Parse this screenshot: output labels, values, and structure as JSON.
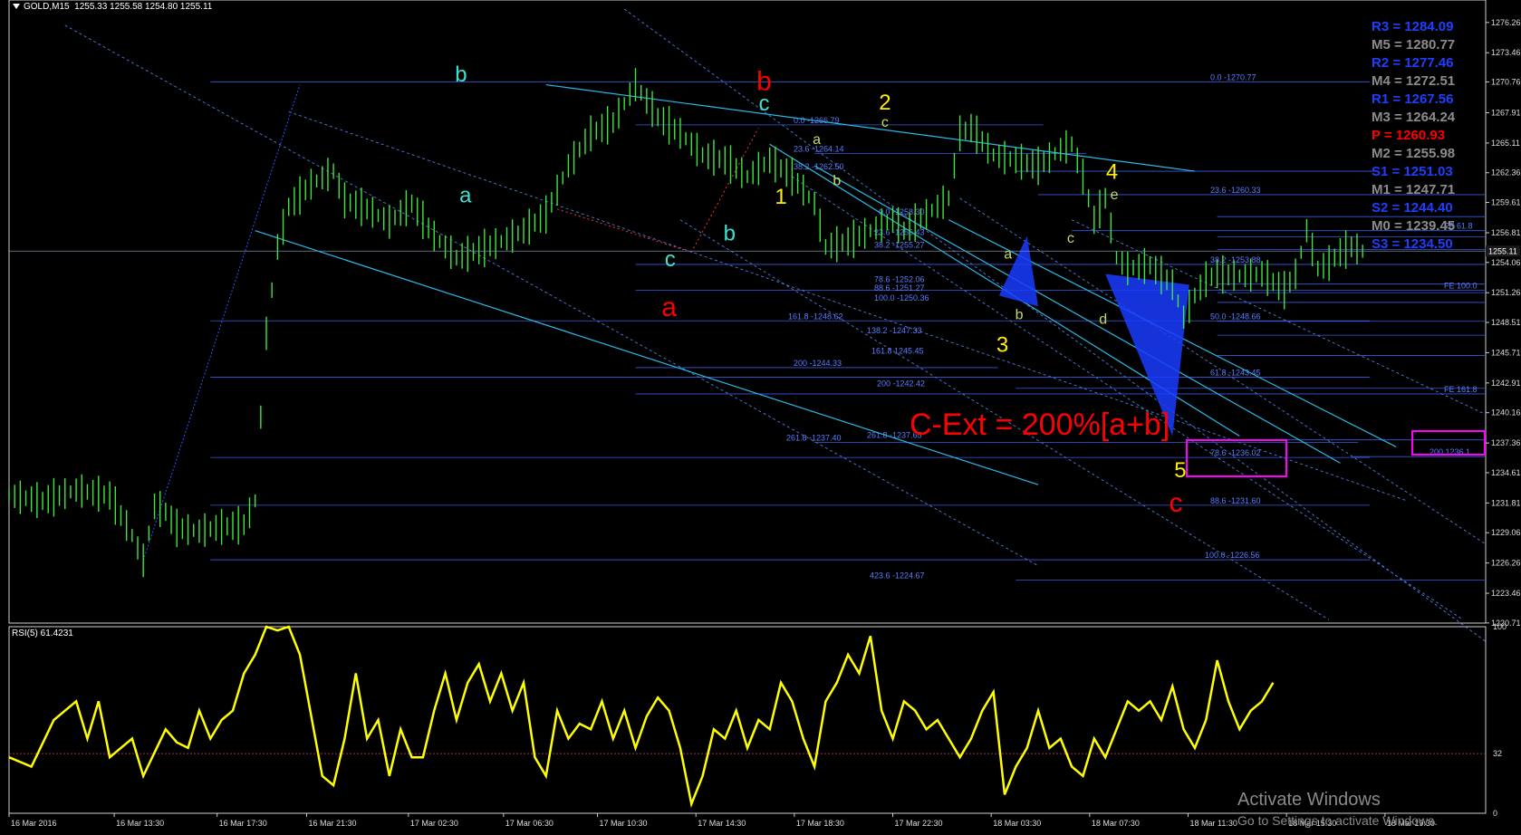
{
  "header": {
    "symbol": "GOLD,M15",
    "ohlc": "1255.33 1255.58 1254.80 1255.11"
  },
  "rsi_label": "RSI(5) 61.4231",
  "pivots": [
    {
      "label": "R3 = 1284.09",
      "color": "#1f3fff"
    },
    {
      "label": "M5 = 1280.77",
      "color": "#8c8c8c"
    },
    {
      "label": "R2 = 1277.46",
      "color": "#1f3fff"
    },
    {
      "label": "M4 = 1272.51",
      "color": "#8c8c8c"
    },
    {
      "label": "R1 = 1267.56",
      "color": "#1f3fff"
    },
    {
      "label": "M3 = 1264.24",
      "color": "#8c8c8c"
    },
    {
      "label": "P  = 1260.93",
      "color": "#ff0000"
    },
    {
      "label": "M2 = 1255.98",
      "color": "#8c8c8c"
    },
    {
      "label": "S1 = 1251.03",
      "color": "#1f3fff"
    },
    {
      "label": "M1 = 1247.71",
      "color": "#8c8c8c"
    },
    {
      "label": "S2 = 1244.40",
      "color": "#1f3fff"
    },
    {
      "label": "M0 = 1239.45",
      "color": "#8c8c8c"
    },
    {
      "label": "S3 = 1234.50",
      "color": "#1f3fff"
    }
  ],
  "annotation": "C-Ext = 200%[a+b]",
  "watermark": {
    "line1": "Activate Windows",
    "line2": "Go to Settings to activate Windows."
  },
  "wave_labels": [
    {
      "text": "b",
      "color": "#40e0d0",
      "time": 40.4,
      "price": 1270.8
    },
    {
      "text": "a",
      "color": "#40e0d0",
      "time": 40.8,
      "price": 1259.6
    },
    {
      "text": "c",
      "color": "#40e0d0",
      "time": 59.1,
      "price": 1253.7
    },
    {
      "text": "b",
      "color": "#40e0d0",
      "time": 64.4,
      "price": 1256.1
    },
    {
      "text": "c",
      "color": "#40e0d0",
      "time": 67.5,
      "price": 1268.1
    },
    {
      "text": "b",
      "color": "#ff0000",
      "time": 67.5,
      "price": 1270.0
    },
    {
      "text": "a",
      "color": "#ff0000",
      "time": 59.0,
      "price": 1249.1
    },
    {
      "text": "c",
      "color": "#ff0000",
      "time": 104.3,
      "price": 1231.0
    },
    {
      "text": "1",
      "color": "#ffee00",
      "time": 69.0,
      "price": 1259.5
    },
    {
      "text": "2",
      "color": "#ffee00",
      "time": 78.3,
      "price": 1268.2
    },
    {
      "text": "3",
      "color": "#ffee00",
      "time": 88.8,
      "price": 1245.8
    },
    {
      "text": "4",
      "color": "#ffee00",
      "time": 98.6,
      "price": 1261.8
    },
    {
      "text": "5",
      "color": "#ffee00",
      "time": 104.7,
      "price": 1234.2
    },
    {
      "text": "a",
      "color": "#c8d860",
      "time": 72.2,
      "price": 1265.0
    },
    {
      "text": "b",
      "color": "#c8d860",
      "time": 74.0,
      "price": 1261.2
    },
    {
      "text": "c",
      "color": "#c8d860",
      "time": 78.3,
      "price": 1266.6
    },
    {
      "text": "a",
      "color": "#c8d860",
      "time": 89.3,
      "price": 1254.4
    },
    {
      "text": "b",
      "color": "#c8d860",
      "time": 90.3,
      "price": 1248.8
    },
    {
      "text": "c",
      "color": "#c8d860",
      "time": 94.9,
      "price": 1255.9
    },
    {
      "text": "d",
      "color": "#c8d860",
      "time": 97.8,
      "price": 1248.4
    },
    {
      "text": "e",
      "color": "#c8d860",
      "time": 98.8,
      "price": 1259.9
    }
  ],
  "chart_data": {
    "type": "candlestick",
    "title": "GOLD,M15",
    "ylim": [
      1220.7,
      1277.5
    ],
    "yticks": [
      "1276.26",
      "1273.46",
      "1270.76",
      "1267.91",
      "1265.11",
      "1262.36",
      "1259.61",
      "1256.81",
      "1254.06",
      "1251.26",
      "1248.51",
      "1245.71",
      "1242.91",
      "1240.16",
      "1237.36",
      "1234.61",
      "1231.81",
      "1229.06",
      "1226.26",
      "1223.46",
      "1220.71"
    ],
    "xticks": [
      {
        "label": "16 Mar 2016",
        "time": 0
      },
      {
        "label": "16 Mar 13:30",
        "time": 9.4
      },
      {
        "label": "16 Mar 17:30",
        "time": 18.6
      },
      {
        "label": "16 Mar 21:30",
        "time": 26.6
      },
      {
        "label": "17 Mar 02:30",
        "time": 35.7
      },
      {
        "label": "17 Mar 06:30",
        "time": 44.2
      },
      {
        "label": "17 Mar 10:30",
        "time": 52.6
      },
      {
        "label": "17 Mar 14:30",
        "time": 61.4
      },
      {
        "label": "17 Mar 18:30",
        "time": 70.2
      },
      {
        "label": "17 Mar 22:30",
        "time": 79.0
      },
      {
        "label": "18 Mar 03:30",
        "time": 87.8
      },
      {
        "label": "18 Mar 07:30",
        "time": 96.6
      },
      {
        "label": "18 Mar 11:30",
        "time": 105.4
      },
      {
        "label": "18 Mar 15:30",
        "time": 114.2
      },
      {
        "label": "18 Mar 19:30",
        "time": 123.0
      }
    ],
    "series": [
      {
        "name": "GOLD,M15",
        "path": [
          [
            0,
            1232.5
          ],
          [
            3,
            1232.0
          ],
          [
            6,
            1233.0
          ],
          [
            9,
            1232.5
          ],
          [
            11,
            1228.8
          ],
          [
            12,
            1226.5
          ],
          [
            13,
            1231.5
          ],
          [
            14,
            1231.0
          ],
          [
            15,
            1229.5
          ],
          [
            17,
            1229.2
          ],
          [
            19,
            1229.6
          ],
          [
            21,
            1229.8
          ],
          [
            22,
            1232.0
          ],
          [
            23,
            1247.5
          ],
          [
            24,
            1255.5
          ],
          [
            25,
            1259.2
          ],
          [
            27,
            1261.3
          ],
          [
            29,
            1262.5
          ],
          [
            30,
            1259.8
          ],
          [
            32,
            1259.0
          ],
          [
            34,
            1257.8
          ],
          [
            36,
            1259.5
          ],
          [
            38,
            1256.5
          ],
          [
            40,
            1254.5
          ],
          [
            42,
            1255.2
          ],
          [
            44,
            1256.0
          ],
          [
            46,
            1257.0
          ],
          [
            48,
            1258.5
          ],
          [
            50,
            1263.0
          ],
          [
            52,
            1266.0
          ],
          [
            54,
            1267.0
          ],
          [
            56,
            1270.5
          ],
          [
            58,
            1267.5
          ],
          [
            60,
            1266.0
          ],
          [
            62,
            1264.0
          ],
          [
            64,
            1263.5
          ],
          [
            66,
            1262.0
          ],
          [
            68,
            1263.5
          ],
          [
            70,
            1262.0
          ],
          [
            72,
            1259.5
          ],
          [
            73,
            1255.5
          ],
          [
            75,
            1256.0
          ],
          [
            77,
            1257.0
          ],
          [
            79,
            1258.0
          ],
          [
            80,
            1257.0
          ],
          [
            82,
            1258.5
          ],
          [
            84,
            1260.0
          ],
          [
            85,
            1266.0
          ],
          [
            86,
            1266.5
          ],
          [
            88,
            1264.0
          ],
          [
            90,
            1263.5
          ],
          [
            92,
            1263.0
          ],
          [
            94,
            1264.5
          ],
          [
            95,
            1265.0
          ],
          [
            96,
            1262.0
          ],
          [
            97,
            1258.0
          ],
          [
            98,
            1260.0
          ],
          [
            99,
            1254.5
          ],
          [
            100,
            1253.5
          ],
          [
            102,
            1253.8
          ],
          [
            104,
            1252.0
          ],
          [
            105,
            1249.0
          ],
          [
            106,
            1251.0
          ],
          [
            107,
            1252.5
          ],
          [
            108,
            1253.0
          ],
          [
            110,
            1252.8
          ],
          [
            112,
            1253.0
          ],
          [
            114,
            1251.5
          ],
          [
            115,
            1253.0
          ],
          [
            116,
            1257.0
          ],
          [
            117,
            1253.5
          ],
          [
            118,
            1254.0
          ],
          [
            119,
            1255.0
          ],
          [
            120,
            1255.5
          ],
          [
            121,
            1255.1
          ]
        ]
      }
    ],
    "rsi": {
      "ylim": [
        0,
        100
      ],
      "level": 32,
      "ticks": [
        "100",
        "32",
        "0"
      ],
      "values": [
        [
          0,
          30
        ],
        [
          2,
          25
        ],
        [
          4,
          50
        ],
        [
          6,
          60
        ],
        [
          7,
          40
        ],
        [
          8,
          60
        ],
        [
          9,
          30
        ],
        [
          11,
          40
        ],
        [
          12,
          20
        ],
        [
          14,
          45
        ],
        [
          15,
          38
        ],
        [
          16,
          35
        ],
        [
          17,
          55
        ],
        [
          18,
          40
        ],
        [
          19,
          50
        ],
        [
          20,
          55
        ],
        [
          21,
          75
        ],
        [
          22,
          85
        ],
        [
          23,
          100
        ],
        [
          24,
          98
        ],
        [
          25,
          102
        ],
        [
          26,
          85
        ],
        [
          28,
          20
        ],
        [
          29,
          15
        ],
        [
          30,
          40
        ],
        [
          31,
          75
        ],
        [
          32,
          40
        ],
        [
          33,
          50
        ],
        [
          34,
          20
        ],
        [
          35,
          45
        ],
        [
          36,
          30
        ],
        [
          37,
          30
        ],
        [
          38,
          55
        ],
        [
          39,
          75
        ],
        [
          40,
          50
        ],
        [
          41,
          70
        ],
        [
          42,
          80
        ],
        [
          43,
          60
        ],
        [
          44,
          75
        ],
        [
          45,
          55
        ],
        [
          46,
          70
        ],
        [
          47,
          30
        ],
        [
          48,
          20
        ],
        [
          49,
          55
        ],
        [
          50,
          40
        ],
        [
          51,
          48
        ],
        [
          52,
          45
        ],
        [
          53,
          60
        ],
        [
          54,
          40
        ],
        [
          55,
          55
        ],
        [
          56,
          35
        ],
        [
          57,
          52
        ],
        [
          58,
          62
        ],
        [
          59,
          55
        ],
        [
          60,
          35
        ],
        [
          61,
          5
        ],
        [
          62,
          20
        ],
        [
          63,
          45
        ],
        [
          64,
          40
        ],
        [
          65,
          55
        ],
        [
          66,
          35
        ],
        [
          67,
          50
        ],
        [
          68,
          45
        ],
        [
          69,
          70
        ],
        [
          70,
          60
        ],
        [
          71,
          40
        ],
        [
          72,
          25
        ],
        [
          73,
          60
        ],
        [
          74,
          70
        ],
        [
          75,
          85
        ],
        [
          76,
          75
        ],
        [
          77,
          95
        ],
        [
          78,
          55
        ],
        [
          79,
          40
        ],
        [
          80,
          60
        ],
        [
          81,
          55
        ],
        [
          82,
          45
        ],
        [
          83,
          50
        ],
        [
          84,
          40
        ],
        [
          85,
          30
        ],
        [
          86,
          40
        ],
        [
          87,
          55
        ],
        [
          88,
          65
        ],
        [
          89,
          10
        ],
        [
          90,
          25
        ],
        [
          91,
          35
        ],
        [
          92,
          55
        ],
        [
          93,
          35
        ],
        [
          94,
          40
        ],
        [
          95,
          25
        ],
        [
          96,
          20
        ],
        [
          97,
          40
        ],
        [
          98,
          30
        ],
        [
          99,
          45
        ],
        [
          100,
          60
        ],
        [
          101,
          55
        ],
        [
          102,
          60
        ],
        [
          103,
          50
        ],
        [
          104,
          68
        ],
        [
          105,
          45
        ],
        [
          106,
          35
        ],
        [
          107,
          50
        ],
        [
          108,
          82
        ],
        [
          109,
          60
        ],
        [
          110,
          45
        ],
        [
          111,
          55
        ],
        [
          112,
          60
        ],
        [
          113,
          70
        ]
      ]
    }
  },
  "fib_levels": [
    {
      "text": "0.0 -1270.77",
      "price": 1270.77
    },
    {
      "text": "0.0 -1266.79",
      "price": 1266.79
    },
    {
      "text": "23.6 -1264.14",
      "price": 1264.14
    },
    {
      "text": "38.2 -1262.50",
      "price": 1262.5
    },
    {
      "text": "23.6 -1260.33",
      "price": 1260.33
    },
    {
      "text": "0.0 -1258.30",
      "price": 1258.3
    },
    {
      "text": "23.6 -1256.43",
      "price": 1256.43
    },
    {
      "text": "38.2 -1255.27",
      "price": 1255.27
    },
    {
      "text": "38.2 -1253.88",
      "price": 1253.88
    },
    {
      "text": "78.6 -1252.06",
      "price": 1252.06
    },
    {
      "text": "88.6 -1251.27",
      "price": 1251.27
    },
    {
      "text": "100.0 -1250.36",
      "price": 1250.36
    },
    {
      "text": "50.0 -1248.66",
      "price": 1248.66
    },
    {
      "text": "161.8 -1248.62",
      "price": 1248.62
    },
    {
      "text": "138.2 -1247.33",
      "price": 1247.33
    },
    {
      "text": "161.8 1245.45",
      "price": 1245.45
    },
    {
      "text": "200 -1244.33",
      "price": 1244.33
    },
    {
      "text": "61.8 -1243.45",
      "price": 1243.45
    },
    {
      "text": "200 -1242.42",
      "price": 1242.42
    },
    {
      "text": "261.8 -1237.40",
      "price": 1237.4
    },
    {
      "text": "261.8 -1237.65",
      "price": 1237.65
    },
    {
      "text": "78.6 -1236.02",
      "price": 1236.02
    },
    {
      "text": "88.6 -1231.60",
      "price": 1231.6
    },
    {
      "text": "100.0 -1226.56",
      "price": 1226.56
    },
    {
      "text": "423.6 -1224.67",
      "price": 1224.67
    },
    {
      "text": "FE 61.8",
      "price": 1257.0
    },
    {
      "text": "FE 100.0",
      "price": 1251.5
    },
    {
      "text": "FE 161.8",
      "price": 1241.9
    },
    {
      "text": "200 1236.1",
      "price": 1236.1
    }
  ]
}
